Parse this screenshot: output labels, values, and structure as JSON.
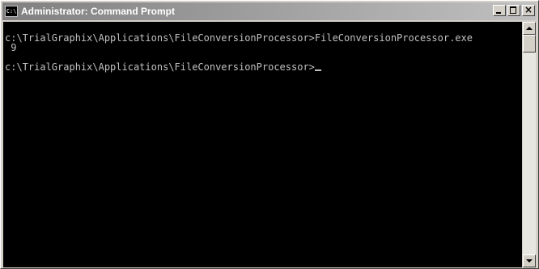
{
  "window": {
    "title": "Administrator: Command Prompt",
    "icon_label": "C:\\",
    "icon": "console-icon",
    "buttons": {
      "minimize": "minimize-icon",
      "maximize": "maximize-icon",
      "close": "close-icon",
      "close_glyph": "×"
    }
  },
  "console": {
    "colors": {
      "background": "#000000",
      "text": "#c0c0c0"
    },
    "lines": [
      "c:\\TrialGraphix\\Applications\\FileConversionProcessor>FileConversionProcessor.exe",
      " 9",
      "c:\\TrialGraphix\\Applications\\FileConversionProcessor>"
    ]
  },
  "scrollbar": {
    "up_icon": "scroll-up-icon",
    "down_icon": "scroll-down-icon"
  }
}
